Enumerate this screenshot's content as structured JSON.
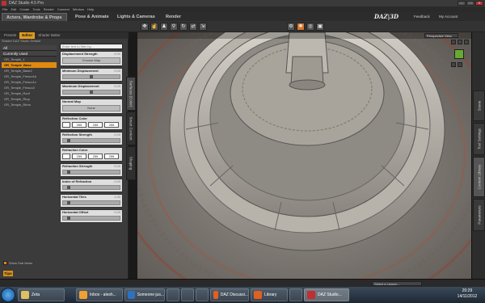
{
  "window": {
    "title": "DAZ Studio 4.5 Pro"
  },
  "menu": [
    "File",
    "Edit",
    "Create",
    "Tools",
    "Render",
    "Connect",
    "Window",
    "Help"
  ],
  "main_tabs": [
    {
      "label": "Actors, Wardrobe & Props",
      "active": true
    },
    {
      "label": "Pose & Animate",
      "active": false
    },
    {
      "label": "Lights & Cameras",
      "active": false
    },
    {
      "label": "Render",
      "active": false
    }
  ],
  "header_links": {
    "logo": "DAZ|3D",
    "feedback": "Feedback",
    "account": "My Account"
  },
  "left_panel": {
    "tabs": [
      "Presets",
      "Editor",
      "Shader Baker"
    ],
    "active_tab": "Editor",
    "header": "Shader DAZ Studio Default",
    "filter_list": {
      "all": "All",
      "currently_used": "Currently Used",
      "items": [
        {
          "label": "GR_Temple_1",
          "selected": false
        },
        {
          "label": "GR_Temple_Base",
          "selected": true
        },
        {
          "label": "GR_Temple_Base2",
          "selected": false
        },
        {
          "label": "GR_Temple_Fresco1b",
          "selected": false
        },
        {
          "label": "GR_Temple_Fresco1c",
          "selected": false
        },
        {
          "label": "GR_Temple_Fresco2",
          "selected": false
        },
        {
          "label": "GR_Temple_Roof",
          "selected": false
        },
        {
          "label": "GR_Temple_Rtop",
          "selected": false
        },
        {
          "label": "GR_Temple_Rtrim",
          "selected": false
        }
      ]
    },
    "show_sub_items": "Show Sub Items",
    "tips": "Tips",
    "search_placeholder": "Enter text to filter by...",
    "properties": [
      {
        "name": "Displacement Strength",
        "value": "0.00",
        "kind": "button",
        "button": "Choose Map"
      },
      {
        "name": "Minimum Displacement",
        "value": "0.00",
        "kind": "slider",
        "level": 0.5
      },
      {
        "name": "Maximum Displacement",
        "value": "0.00",
        "kind": "slider",
        "level": 0.5
      },
      {
        "name": "Normal Map",
        "value": "",
        "kind": "button",
        "button": "None"
      },
      {
        "name": "Reflection Color",
        "value": "",
        "kind": "color",
        "rgb": [
          "255",
          "255",
          "255"
        ]
      },
      {
        "name": "Reflection Strength",
        "value": "0.00",
        "kind": "slider",
        "level": 0.1
      },
      {
        "name": "Refraction Color",
        "value": "",
        "kind": "color",
        "rgb": [
          "255",
          "255",
          "255"
        ]
      },
      {
        "name": "Refraction Strength",
        "value": "0.00",
        "kind": "slider",
        "level": 0.1
      },
      {
        "name": "Index of Refraction",
        "value": "0.00",
        "kind": "slider",
        "level": 0.1
      },
      {
        "name": "Horizontal Tiles",
        "value": "1.00",
        "kind": "slider",
        "level": 0.1
      },
      {
        "name": "Horizontal Offset",
        "value": "0.00",
        "kind": "slider",
        "level": 0.1
      }
    ],
    "side_tabs": [
      "Surfaces (Color)",
      "Smart Content",
      "Shaping"
    ]
  },
  "viewport": {
    "view": "Perspective View"
  },
  "right_dock_tabs": [
    "Scene",
    "Tool Settings",
    "Content Library",
    "Parameters"
  ],
  "status": {
    "lesson_select": "Select a Lesson..."
  },
  "taskbar": {
    "buttons": [
      {
        "label": "Zeta",
        "color": "#e0c060"
      },
      {
        "label": "Inbox - alesh...",
        "color": "#f0a030"
      },
      {
        "label": "Someone jus...",
        "color": "#3070c0"
      },
      {
        "label": "DAZ Discussi...",
        "color": "#e06020"
      },
      {
        "label": "Library",
        "color": "#e06020"
      },
      {
        "label": "DAZ Studio...",
        "color": "#c03030"
      }
    ],
    "time": "20:29",
    "date": "14/11/2012"
  }
}
